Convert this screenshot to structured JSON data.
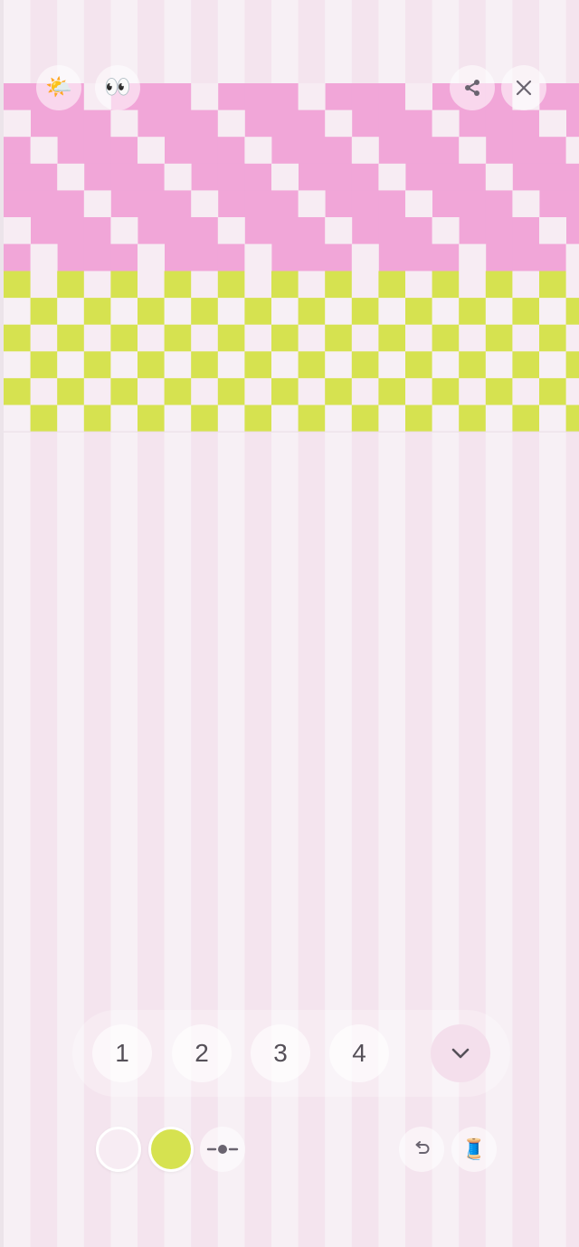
{
  "colors": {
    "bg_stripe_a": "#f7f0f5",
    "bg_stripe_b": "#f4e4ee",
    "pink": "#f1a6d8",
    "light": "#f7ecf3",
    "green": "#d6e250",
    "icon": "#6a6470"
  },
  "header": {
    "weather_icon": "🌤️",
    "eyes_icon": "👀"
  },
  "layers": {
    "buttons": [
      {
        "label": "1"
      },
      {
        "label": "2"
      },
      {
        "label": "3"
      },
      {
        "label": "4"
      }
    ]
  },
  "toolbar": {
    "spool_icon": "🧵"
  }
}
